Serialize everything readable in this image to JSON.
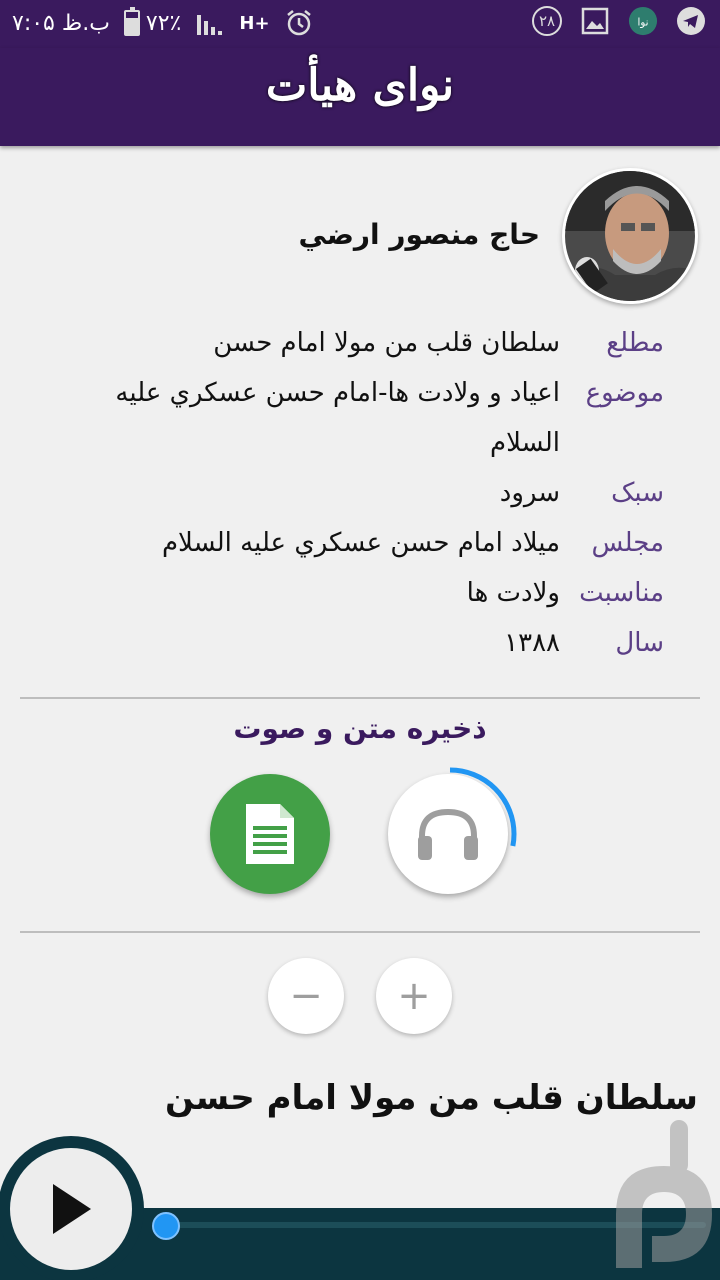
{
  "status_bar": {
    "time": "۷:۰۵ ب.ظ",
    "battery": "۷۲٪",
    "battery_level": 0.72,
    "network": "H+",
    "notification_count": "۲۸"
  },
  "app": {
    "title": "نوای هیأت"
  },
  "singer": {
    "name": "حاج منصور ارضي"
  },
  "details": [
    {
      "label": "مطلع",
      "value": "سلطان قلب من مولا امام حسن"
    },
    {
      "label": "موضوع",
      "value": "اعياد و ولادت ها-امام حسن عسکري عليه السلام"
    },
    {
      "label": "سبک",
      "value": "سرود"
    },
    {
      "label": "مجلس",
      "value": "ميلاد امام حسن عسکري عليه السلام"
    },
    {
      "label": "مناسبت",
      "value": "ولادت ها"
    },
    {
      "label": "سال",
      "value": "۱۳۸۸"
    }
  ],
  "save_section": {
    "title": "ذخيره متن و صوت",
    "text_icon": "document-icon",
    "audio_icon": "headphones-icon",
    "audio_progress": 0.28
  },
  "font_controls": {
    "minus": "−",
    "plus": "+"
  },
  "lyrics": {
    "title": "سلطان قلب من مولا امام حسن"
  },
  "player": {
    "progress": 0,
    "play_icon": "play-icon"
  },
  "colors": {
    "primary": "#3a1a5e",
    "label": "#5b3f86",
    "green": "#43a047",
    "accent": "#2196f3",
    "player_bg": "#0c3540"
  }
}
